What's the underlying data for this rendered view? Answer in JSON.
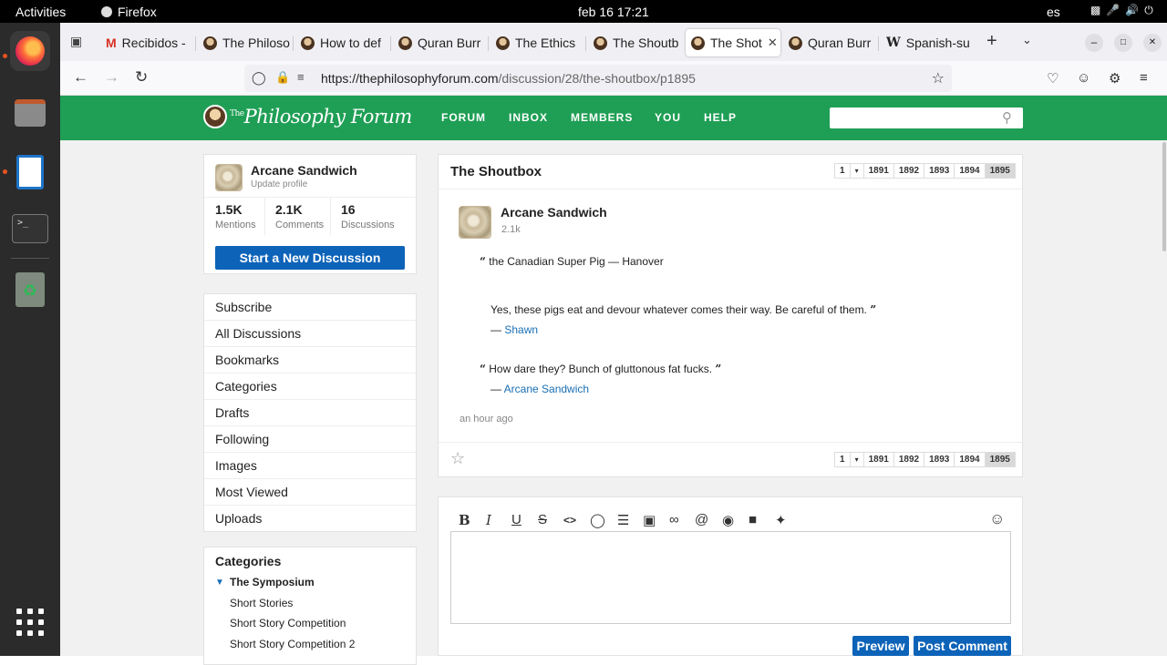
{
  "topbar": {
    "activities": "Activities",
    "app": "Firefox",
    "clock": "feb 16  17:21",
    "lang": "es"
  },
  "tabs": [
    {
      "label": "Recibidos -",
      "icon": "gmail-icon"
    },
    {
      "label": "The Philoso",
      "icon": "forum-icon"
    },
    {
      "label": "How to def",
      "icon": "forum-icon"
    },
    {
      "label": "Quran Burr",
      "icon": "forum-icon"
    },
    {
      "label": "The Ethics",
      "icon": "forum-icon"
    },
    {
      "label": "The Shoutb",
      "icon": "forum-icon"
    },
    {
      "label": "The Shot",
      "icon": "forum-icon",
      "active": true
    },
    {
      "label": "Quran Burr",
      "icon": "forum-icon"
    },
    {
      "label": "Spanish-su",
      "icon": "wikipedia-icon"
    }
  ],
  "url": {
    "host": "https://thephilosophyforum.com",
    "path": "/discussion/28/the-shoutbox/p1895"
  },
  "site": {
    "logo_sup": "The",
    "logo": "Philosophy Forum",
    "nav": [
      "FORUM",
      "INBOX",
      "MEMBERS",
      "YOU",
      "HELP"
    ]
  },
  "profile": {
    "name": "Arcane Sandwich",
    "sub": "Update profile",
    "stats": [
      {
        "value": "1.5K",
        "label": "Mentions"
      },
      {
        "value": "2.1K",
        "label": "Comments"
      },
      {
        "value": "16",
        "label": "Discussions"
      }
    ],
    "cta": "Start a New Discussion"
  },
  "menu": [
    "Subscribe",
    "All Discussions",
    "Bookmarks",
    "Categories",
    "Drafts",
    "Following",
    "Images",
    "Most Viewed",
    "Uploads"
  ],
  "categories": {
    "title": "Categories",
    "group": "The Symposium",
    "items": [
      "Short Stories",
      "Short Story Competition",
      "Short Story Competition 2"
    ]
  },
  "discussion": {
    "title": "The Shoutbox",
    "pager": [
      "1",
      "▾",
      "1891",
      "1892",
      "1893",
      "1894",
      "1895"
    ],
    "comment": {
      "author": "Arcane Sandwich",
      "count": "2.1k",
      "q1": "the Canadian Super Pig — Hanover",
      "q2": "Yes, these pigs eat and devour whatever comes their way. Be careful of them.",
      "q2_dash": "— ",
      "q2_author": "Shawn",
      "q3": "How dare they? Bunch of gluttonous fat fucks.",
      "q3_dash": "— ",
      "q3_author": "Arcane Sandwich",
      "time": "an hour ago"
    }
  },
  "editor": {
    "preview": "Preview",
    "post": "Post Comment"
  }
}
